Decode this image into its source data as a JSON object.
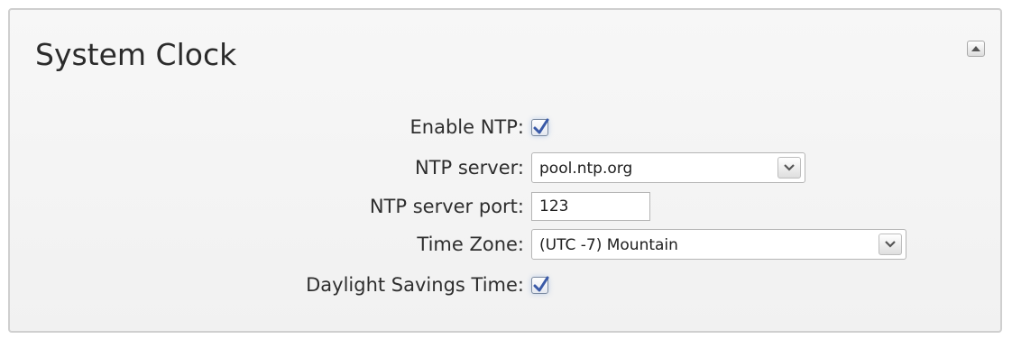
{
  "panel": {
    "title": "System Clock",
    "collapse_icon": "triangle-up-icon"
  },
  "form": {
    "enable_ntp": {
      "label": "Enable NTP:",
      "checked": true
    },
    "ntp_server": {
      "label": "NTP server:",
      "value": "pool.ntp.org"
    },
    "ntp_server_port": {
      "label": "NTP server port:",
      "value": "123"
    },
    "time_zone": {
      "label": "Time Zone:",
      "value": "(UTC -7) Mountain"
    },
    "daylight_savings": {
      "label": "Daylight Savings Time:",
      "checked": true
    }
  },
  "colors": {
    "panel_bg": "#f4f4f4",
    "panel_border": "#cfcfcf",
    "check_mark": "#3a5aa8"
  }
}
